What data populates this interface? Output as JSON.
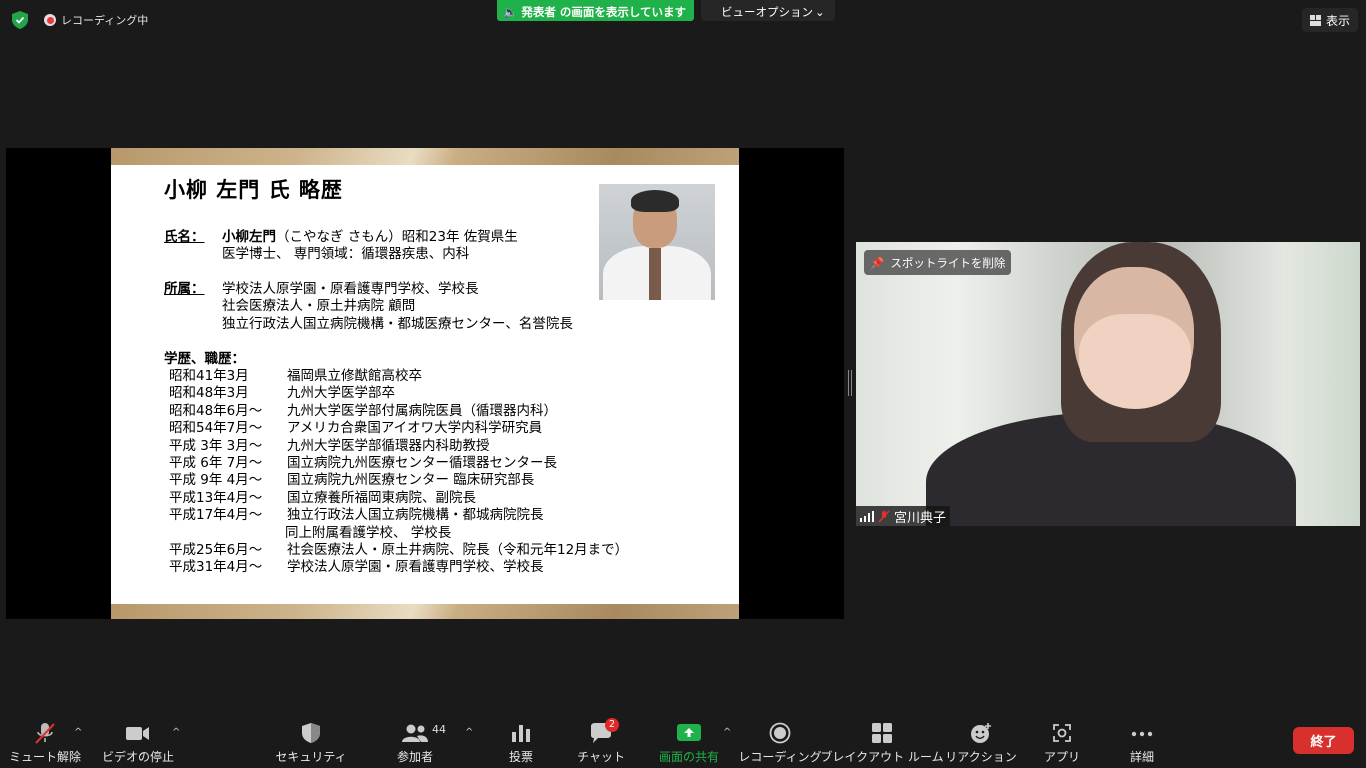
{
  "top_bar": {
    "recording_label": "レコーディング中",
    "sharing_banner": "発表者 の画面を表示しています",
    "view_options_label": "ビューオプション",
    "view_label": "表示"
  },
  "slide": {
    "title": "小柳 左門 氏 略歴",
    "name_label": "氏名：",
    "name_bold": "小柳左門",
    "name_rest": "（こやなぎ さもん）昭和23年 佐賀県生",
    "name_line2": "医学博士、 専門領域：循環器疾患、内科",
    "affil_label": "所属：",
    "affil_lines": [
      "学校法人原学園・原看護専門学校、学校長",
      "社会医療法人・原土井病院 顧問",
      "独立行政法人国立病院機構・都城医療センター、名誉院長"
    ],
    "history_label": "学歴、職歴：",
    "history": [
      {
        "date": "昭和41年3月",
        "text": "福岡県立修猷館高校卒"
      },
      {
        "date": "昭和48年3月",
        "text": "九州大学医学部卒"
      },
      {
        "date": "昭和48年6月～",
        "text": "九州大学医学部付属病院医員（循環器内科）"
      },
      {
        "date": "昭和54年7月～",
        "text": "アメリカ合衆国アイオワ大学内科学研究員"
      },
      {
        "date": "平成 3年 3月～",
        "text": "九州大学医学部循環器内科助教授"
      },
      {
        "date": "平成 6年 7月～",
        "text": "国立病院九州医療センター循環器センター長"
      },
      {
        "date": "平成 9年 4月～",
        "text": "国立病院九州医療センター 臨床研究部長"
      },
      {
        "date": "平成13年4月～",
        "text": "国立療養所福岡東病院、副院長"
      },
      {
        "date": "平成17年4月～",
        "text": "独立行政法人国立病院機構・都城病院院長"
      },
      {
        "date": "",
        "text": "同上附属看護学校、 学校長"
      },
      {
        "date": "平成25年6月～",
        "text": "社会医療法人・原土井病院、院長（令和元年12月まで）"
      },
      {
        "date": "平成31年4月～",
        "text": "学校法人原学園・原看護専門学校、学校長"
      }
    ]
  },
  "video": {
    "spotlight_label": "スポットライトを削除",
    "participant_name": "宮川典子"
  },
  "toolbar": {
    "unmute": "ミュート解除",
    "stop_video": "ビデオの停止",
    "security": "セキュリティ",
    "participants": "参加者",
    "participants_count": "44",
    "polls": "投票",
    "chat": "チャット",
    "chat_badge": "2",
    "share_screen": "画面の共有",
    "recording": "レコーディング",
    "breakout": "ブレイクアウト ルーム",
    "reactions": "リアクション",
    "apps": "アプリ",
    "more": "詳細",
    "end": "終了"
  },
  "colors": {
    "share_green": "#20b24a",
    "end_red": "#d8302d",
    "badge_red": "#e02828"
  }
}
